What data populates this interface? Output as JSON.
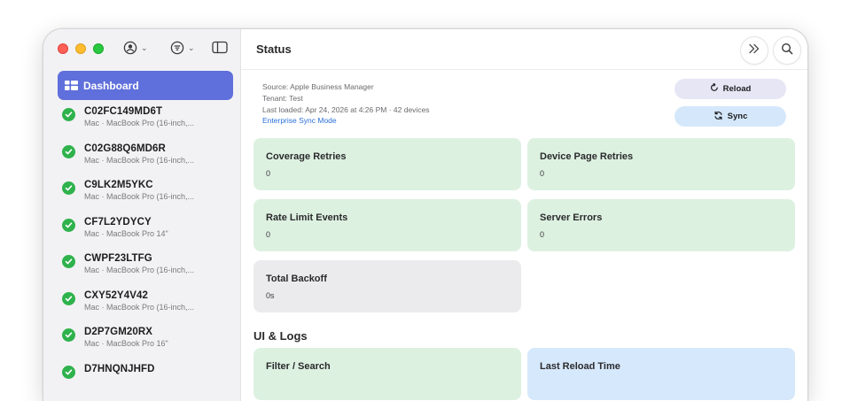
{
  "window": {
    "title": "Status"
  },
  "sidebar": {
    "dashboard_label": "Dashboard",
    "devices": [
      {
        "serial": "C02FC149MD6T",
        "model": "Mac · MacBook Pro (16-inch,..."
      },
      {
        "serial": "C02G88Q6MD6R",
        "model": "Mac · MacBook Pro (16-inch,..."
      },
      {
        "serial": "C9LK2M5YKC",
        "model": "Mac · MacBook Pro (16-inch,..."
      },
      {
        "serial": "CF7L2YDYCY",
        "model": "Mac · MacBook Pro 14\""
      },
      {
        "serial": "CWPF23LTFG",
        "model": "Mac · MacBook Pro (16-inch,..."
      },
      {
        "serial": "CXY52Y4V42",
        "model": "Mac · MacBook Pro (16-inch,..."
      },
      {
        "serial": "D2P7GM20RX",
        "model": "Mac · MacBook Pro 16\""
      },
      {
        "serial": "D7HNQNJHFD",
        "model": ""
      }
    ]
  },
  "info": {
    "source": "Source: Apple Business Manager",
    "tenant": "Tenant: Test",
    "last_loaded": "Last loaded: Apr 24, 2026 at 4:26 PM · 42 devices",
    "mode_link": "Enterprise Sync Mode"
  },
  "buttons": {
    "reload": "Reload",
    "sync": "Sync"
  },
  "stats": [
    {
      "title": "Coverage Retries",
      "value": "0"
    },
    {
      "title": "Device Page Retries",
      "value": "0"
    },
    {
      "title": "Rate Limit Events",
      "value": "0"
    },
    {
      "title": "Server Errors",
      "value": "0"
    },
    {
      "title": "Total Backoff",
      "value": "0s"
    }
  ],
  "section_ui_logs": {
    "heading": "UI & Logs",
    "cards": [
      {
        "title": "Filter / Search"
      },
      {
        "title": "Last Reload Time"
      }
    ]
  },
  "colors": {
    "accent": "#5f6fdb",
    "success": "#2fb24c",
    "card_green": "#ddf1e1",
    "card_gray": "#ebebed",
    "card_blue": "#d6e8fb",
    "link": "#2a6fdb"
  },
  "icons": [
    "person-circle-icon",
    "filter-icon",
    "sidebar-toggle-icon",
    "forward-icon",
    "search-icon",
    "dashboard-icon",
    "checkmark-icon",
    "reload-icon",
    "sync-icon"
  ]
}
